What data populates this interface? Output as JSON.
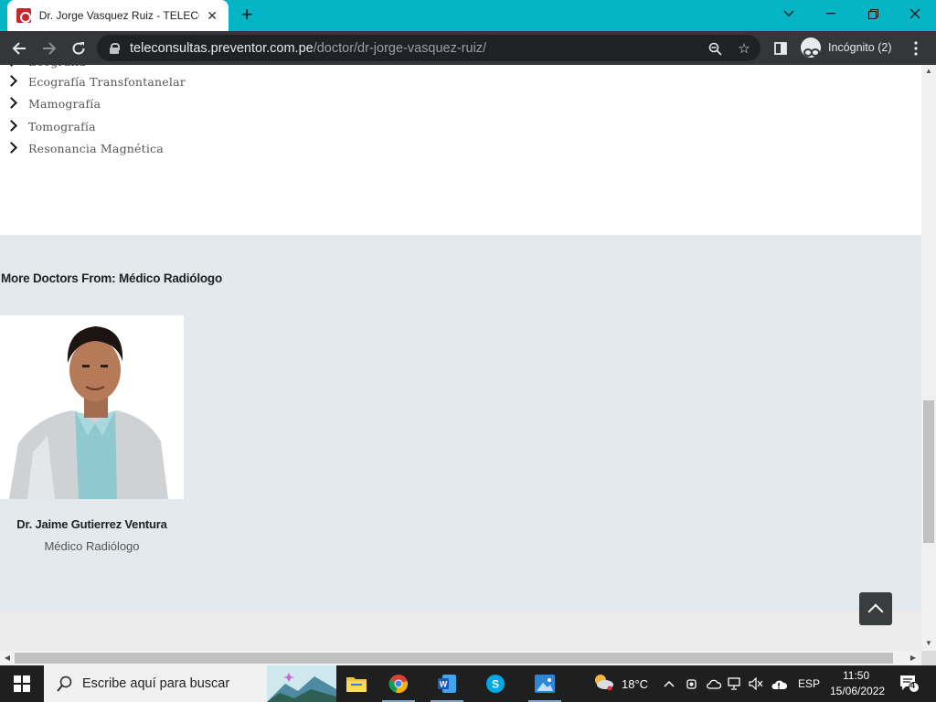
{
  "browser": {
    "tab_title": "Dr. Jorge Vasquez Ruiz - TELECONSULTAS",
    "url_host": "teleconsultas.preventor.com.pe",
    "url_path": "/doctor/dr-jorge-vasquez-ruiz/",
    "profile_label": "Incógnito (2)",
    "accent_color": "#02b4c4"
  },
  "page": {
    "services": [
      "Ecografía Transfontanelar",
      "Mamografía",
      "Tomografía",
      "Resonancia Magnética"
    ],
    "more_doctors_title": "More Doctors From: Médico Radiólogo",
    "doctors": [
      {
        "name": "Dr. Jaime Gutierrez Ventura",
        "specialty": "Médico Radiólogo"
      }
    ]
  },
  "taskbar": {
    "search_placeholder": "Escribe aquí para buscar",
    "weather": "18°C",
    "language": "ESP",
    "time": "11:50",
    "date": "15/06/2022",
    "notifications": "4"
  }
}
